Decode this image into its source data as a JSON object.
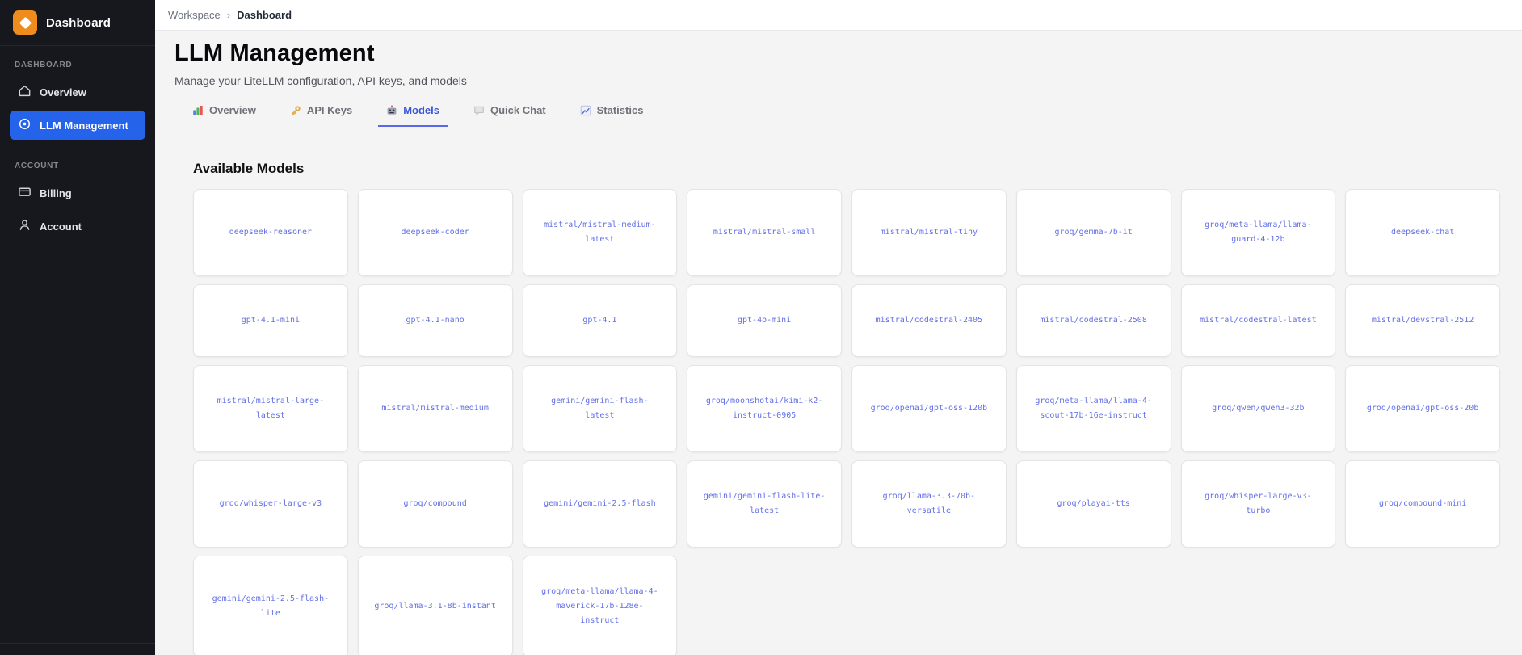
{
  "sidebar": {
    "logo": {
      "text": "Dashboard",
      "icon": "diamond-logo-icon"
    },
    "sections": [
      {
        "label": "DASHBOARD",
        "items": [
          {
            "label": "Overview",
            "icon": "home-icon",
            "active": false
          },
          {
            "label": "LLM Management",
            "icon": "target-icon",
            "active": true
          }
        ]
      },
      {
        "label": "ACCOUNT",
        "items": [
          {
            "label": "Billing",
            "icon": "credit-card-icon",
            "active": false
          },
          {
            "label": "Account",
            "icon": "user-icon",
            "active": false
          }
        ]
      }
    ]
  },
  "breadcrumb": {
    "path": [
      "Workspace",
      "Dashboard"
    ],
    "separator": "›"
  },
  "page_header": {
    "title": "LLM Management",
    "subtitle": "Manage your LiteLLM configuration, API keys, and models"
  },
  "tabs": [
    {
      "label": "Overview",
      "icon": "bar-chart-icon",
      "active": false
    },
    {
      "label": "API Keys",
      "icon": "key-icon",
      "active": false
    },
    {
      "label": "Models",
      "icon": "robot-icon",
      "active": true
    },
    {
      "label": "Quick Chat",
      "icon": "speech-bubble-icon",
      "active": false
    },
    {
      "label": "Statistics",
      "icon": "line-chart-icon",
      "active": false
    }
  ],
  "models_section": {
    "heading": "Available Models",
    "models": [
      "deepseek-reasoner",
      "deepseek-coder",
      "mistral/mistral-medium-latest",
      "mistral/mistral-small",
      "mistral/mistral-tiny",
      "groq/gemma-7b-it",
      "groq/meta-llama/llama-guard-4-12b",
      "deepseek-chat",
      "gpt-4.1-mini",
      "gpt-4.1-nano",
      "gpt-4.1",
      "gpt-4o-mini",
      "mistral/codestral-2405",
      "mistral/codestral-2508",
      "mistral/codestral-latest",
      "mistral/devstral-2512",
      "mistral/mistral-large-latest",
      "mistral/mistral-medium",
      "gemini/gemini-flash-latest",
      "groq/moonshotai/kimi-k2-instruct-0905",
      "groq/openai/gpt-oss-120b",
      "groq/meta-llama/llama-4-scout-17b-16e-instruct",
      "groq/qwen/qwen3-32b",
      "groq/openai/gpt-oss-20b",
      "groq/whisper-large-v3",
      "groq/compound",
      "gemini/gemini-2.5-flash",
      "gemini/gemini-flash-lite-latest",
      "groq/llama-3.3-70b-versatile",
      "groq/playai-tts",
      "groq/whisper-large-v3-turbo",
      "groq/compound-mini",
      "gemini/gemini-2.5-flash-lite",
      "groq/llama-3.1-8b-instant",
      "groq/meta-llama/llama-4-maverick-17b-128e-instruct"
    ]
  },
  "colors": {
    "sidebar_bg": "#16181d",
    "active_item_blue": "#2563eb",
    "logo_orange": "#ee8c1e",
    "active_tab_blue": "#3d56d6",
    "tab_underline": "#5a67ea",
    "model_text_blue": "#6270e6",
    "content_bg": "#f4f4f5"
  }
}
